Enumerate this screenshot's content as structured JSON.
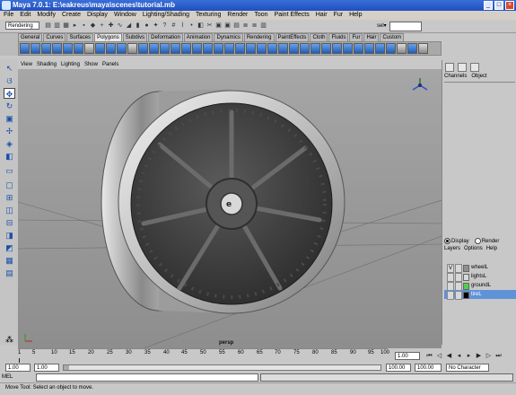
{
  "window": {
    "title": "Maya 7.0.1: E:\\eakreus\\maya\\scenes\\tutorial.mb",
    "buttons": [
      "_",
      "□",
      "×"
    ]
  },
  "menubar": [
    "File",
    "Edit",
    "Modify",
    "Create",
    "Display",
    "Window",
    "Lighting/Shading",
    "Texturing",
    "Render",
    "Toon",
    "Paint Effects",
    "Hair",
    "Fur",
    "Help"
  ],
  "status_line": {
    "menu_set": "Rendering",
    "sel_label": "sel▾"
  },
  "shelf": {
    "tabs": [
      "General",
      "Curves",
      "Surfaces",
      "Polygons",
      "Subdivs",
      "Deformation",
      "Animation",
      "Dynamics",
      "Rendering",
      "PaintEffects",
      "Cloth",
      "Fluids",
      "Fur",
      "Hair",
      "Custom"
    ],
    "active_tab": "Polygons"
  },
  "panel_menu": [
    "View",
    "Shading",
    "Lighting",
    "Show",
    "Panels"
  ],
  "viewport": {
    "camera": "persp"
  },
  "channel_box": {
    "tabs": [
      "Channels",
      "Object"
    ]
  },
  "layer_editor": {
    "radio_display": "Display",
    "radio_render": "Render",
    "menu": [
      "Layers",
      "Options",
      "Help"
    ],
    "layers": [
      {
        "visible": "V",
        "name": "wheelL",
        "color": "#909090",
        "selected": false
      },
      {
        "visible": "",
        "name": "lightsL",
        "color": "#d8d8d8",
        "selected": false
      },
      {
        "visible": "",
        "name": "groundL",
        "color": "#4fd04a",
        "selected": false
      },
      {
        "visible": "",
        "name": "tireL",
        "color": "#000000",
        "selected": true
      }
    ]
  },
  "time_slider": {
    "ticks": [
      "1",
      "5",
      "10",
      "15",
      "20",
      "25",
      "30",
      "35",
      "40",
      "45",
      "50",
      "55",
      "60",
      "65",
      "70",
      "75",
      "80",
      "85",
      "90",
      "95",
      "100"
    ],
    "current_frame": "1.00"
  },
  "range_slider": {
    "start": "1.00",
    "inner_start": "1.00",
    "inner_end": "100.00",
    "end": "100.00",
    "character_set": "No Character Set"
  },
  "command_line": {
    "label": "MEL"
  },
  "help_line": "Move Tool: Select an object to move."
}
